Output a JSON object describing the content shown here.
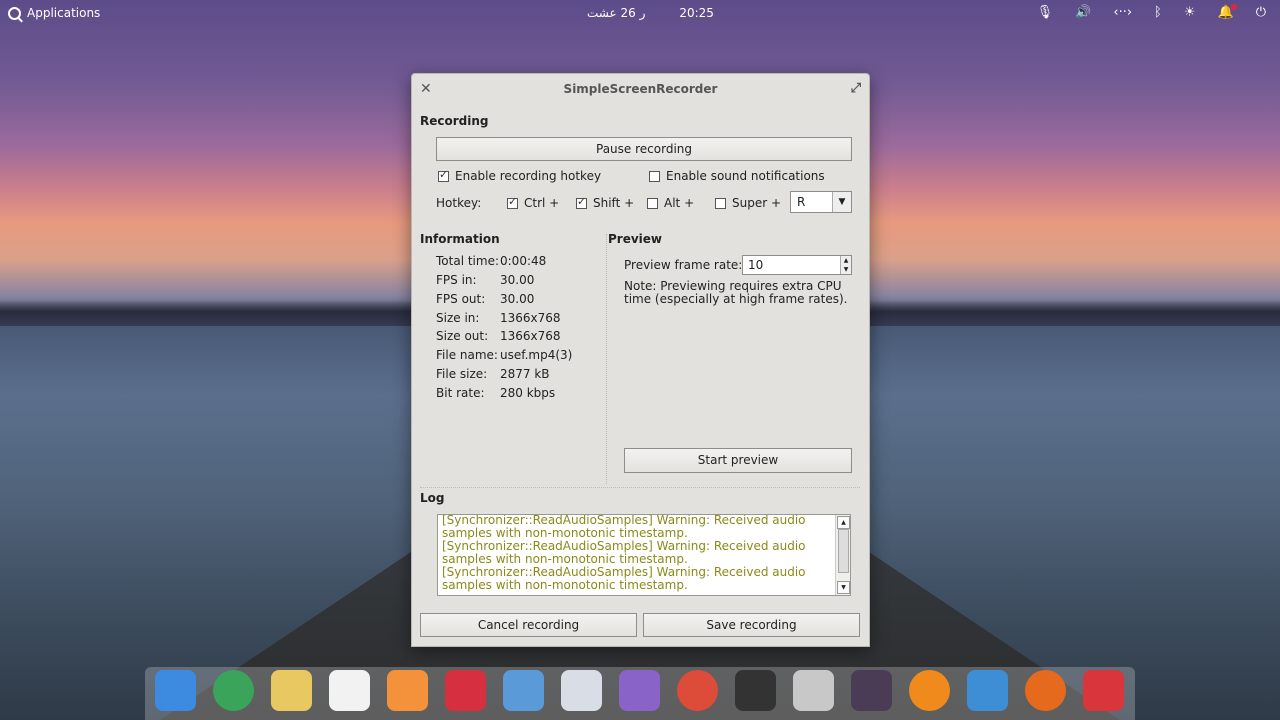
{
  "panel": {
    "applications_label": "Applications",
    "date": "ر 26 عشت",
    "time": "20:25"
  },
  "window": {
    "title": "SimpleScreenRecorder",
    "recording": {
      "heading": "Recording",
      "pause_button": "Pause recording",
      "enable_hotkey_label": "Enable recording hotkey",
      "enable_hotkey_checked": true,
      "sound_notifications_label": "Enable sound notifications",
      "sound_notifications_checked": false,
      "hotkey_label": "Hotkey:",
      "modifiers": [
        {
          "label": "Ctrl +",
          "checked": true
        },
        {
          "label": "Shift +",
          "checked": true
        },
        {
          "label": "Alt +",
          "checked": false
        },
        {
          "label": "Super +",
          "checked": false
        }
      ],
      "key_value": "R"
    },
    "information": {
      "heading": "Information",
      "rows": [
        {
          "key": "Total time:",
          "value": "0:00:48"
        },
        {
          "key": "FPS in:",
          "value": "30.00"
        },
        {
          "key": "FPS out:",
          "value": "30.00"
        },
        {
          "key": "Size in:",
          "value": "1366x768"
        },
        {
          "key": "Size out:",
          "value": "1366x768"
        },
        {
          "key": "File name:",
          "value": "usef.mp4(3)"
        },
        {
          "key": "File size:",
          "value": "2877 kB"
        },
        {
          "key": "Bit rate:",
          "value": "280 kbps"
        }
      ]
    },
    "preview": {
      "heading": "Preview",
      "frame_rate_label": "Preview frame rate:",
      "frame_rate_value": "10",
      "note_line1": "Note: Previewing requires extra CPU",
      "note_line2": "time (especially at high frame rates).",
      "start_button": "Start preview"
    },
    "log": {
      "heading": "Log",
      "lines": [
        "[Synchronizer::ReadAudioSamples] Warning: Received audio",
        "samples with non-monotonic timestamp.",
        "[Synchronizer::ReadAudioSamples] Warning: Received audio",
        "samples with non-monotonic timestamp.",
        "[Synchronizer::ReadAudioSamples] Warning: Received audio",
        "samples with non-monotonic timestamp."
      ]
    },
    "cancel_button": "Cancel recording",
    "save_button": "Save recording"
  },
  "dock": {
    "apps": [
      {
        "name": "multitasking-view-icon",
        "color": "#3d8be0"
      },
      {
        "name": "web-browser-icon",
        "color": "#3aa55a"
      },
      {
        "name": "mail-icon",
        "color": "#e8c860"
      },
      {
        "name": "calendar-icon",
        "color": "#f2f2f2"
      },
      {
        "name": "music-icon",
        "color": "#f3923a"
      },
      {
        "name": "videos-icon",
        "color": "#d63040"
      },
      {
        "name": "photos-icon",
        "color": "#5a9ad8"
      },
      {
        "name": "settings-icon",
        "color": "#d8dde6"
      },
      {
        "name": "app-center-icon",
        "color": "#8a63c8"
      },
      {
        "name": "chrome-icon",
        "color": "#dd4b39"
      },
      {
        "name": "terminal-icon",
        "color": "#333333"
      },
      {
        "name": "files-icon",
        "color": "#c8c8c8"
      },
      {
        "name": "phone-icon",
        "color": "#4a3c55"
      },
      {
        "name": "play-icon",
        "color": "#f08a1c"
      },
      {
        "name": "system-monitor-icon",
        "color": "#3e8ed6"
      },
      {
        "name": "firefox-icon",
        "color": "#e66a1e"
      },
      {
        "name": "screen-recorder-icon",
        "color": "#d8353c"
      }
    ]
  }
}
